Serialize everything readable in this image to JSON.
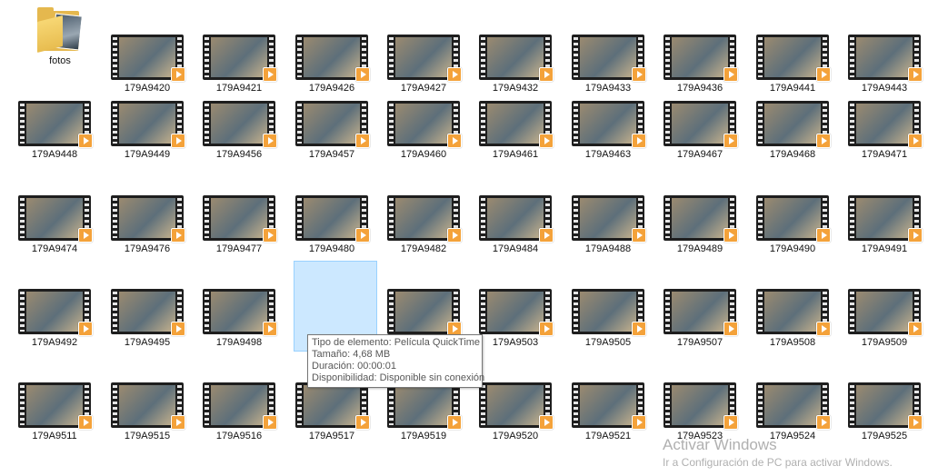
{
  "folder": {
    "label": "fotos",
    "icon": "folder-icon"
  },
  "items": [
    "179A9420",
    "179A9421",
    "179A9426",
    "179A9427",
    "179A9432",
    "179A9433",
    "179A9436",
    "179A9441",
    "179A9443",
    "179A9448",
    "179A9449",
    "179A9456",
    "179A9457",
    "179A9460",
    "179A9461",
    "179A9463",
    "179A9467",
    "179A9468",
    "179A9471",
    "179A9474",
    "179A9476",
    "179A9477",
    "179A9480",
    "179A9482",
    "179A9484",
    "179A9488",
    "179A9489",
    "179A9490",
    "179A9491",
    "179A9492",
    "179A9495",
    "179A9498",
    "",
    "",
    "179A9503",
    "179A9505",
    "179A9507",
    "179A9508",
    "179A9509",
    "179A9511",
    "179A9515",
    "179A9516",
    "179A9517",
    "179A9519",
    "179A9520",
    "179A9521",
    "179A9523",
    "179A9524",
    "179A9525"
  ],
  "selected_index": 32,
  "tooltip": {
    "type": "Tipo de elemento: Película QuickTime",
    "size": "Tamaño: 4,68 MB",
    "duration": "Duración: 00:00:01",
    "availability": "Disponibilidad: Disponible sin conexión"
  },
  "watermark": {
    "title": "Activar Windows",
    "subtitle": "Ir a Configuración de PC para activar Windows."
  },
  "icons": {
    "video": "video-file-icon",
    "play": "play-badge-icon"
  },
  "colors": {
    "selection": "#cce8ff",
    "play_badge": "#f4a23a",
    "folder": "#e5b84e"
  }
}
